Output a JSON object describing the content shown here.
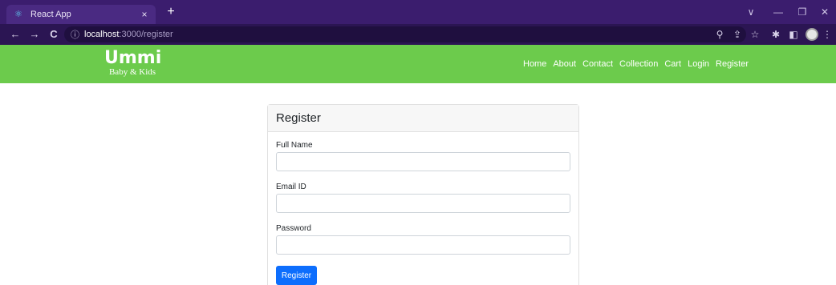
{
  "browser": {
    "tab": {
      "title": "React App",
      "favicon": "react-icon",
      "close": "×"
    },
    "new_tab": "+",
    "window_controls": {
      "dropdown": "∨",
      "minimize": "—",
      "restore": "❐",
      "close": "✕"
    },
    "nav": {
      "back": "←",
      "forward": "→",
      "reload": "C"
    },
    "url": {
      "info": "ⓘ",
      "host": "localhost",
      "path": ":3000/register"
    },
    "toolbar": {
      "zoom": "⚲",
      "share": "⇪",
      "star": "☆",
      "extensions": "✱",
      "sidepanel": "◧",
      "menu": "⋮"
    }
  },
  "site": {
    "brand": {
      "name": "Ummi",
      "tagline": "Baby & Kids"
    },
    "menu": [
      "Home",
      "About",
      "Contact",
      "Collection",
      "Cart",
      "Login",
      "Register"
    ],
    "colors": {
      "navbar": "#6ccb4c",
      "primary": "#0d6efd",
      "chrome": "#3b1d6e"
    }
  },
  "form": {
    "title": "Register",
    "fields": [
      {
        "label": "Full Name",
        "value": "",
        "placeholder": ""
      },
      {
        "label": "Email ID",
        "value": "",
        "placeholder": ""
      },
      {
        "label": "Password",
        "value": "",
        "placeholder": ""
      }
    ],
    "submit_label": "Register"
  }
}
